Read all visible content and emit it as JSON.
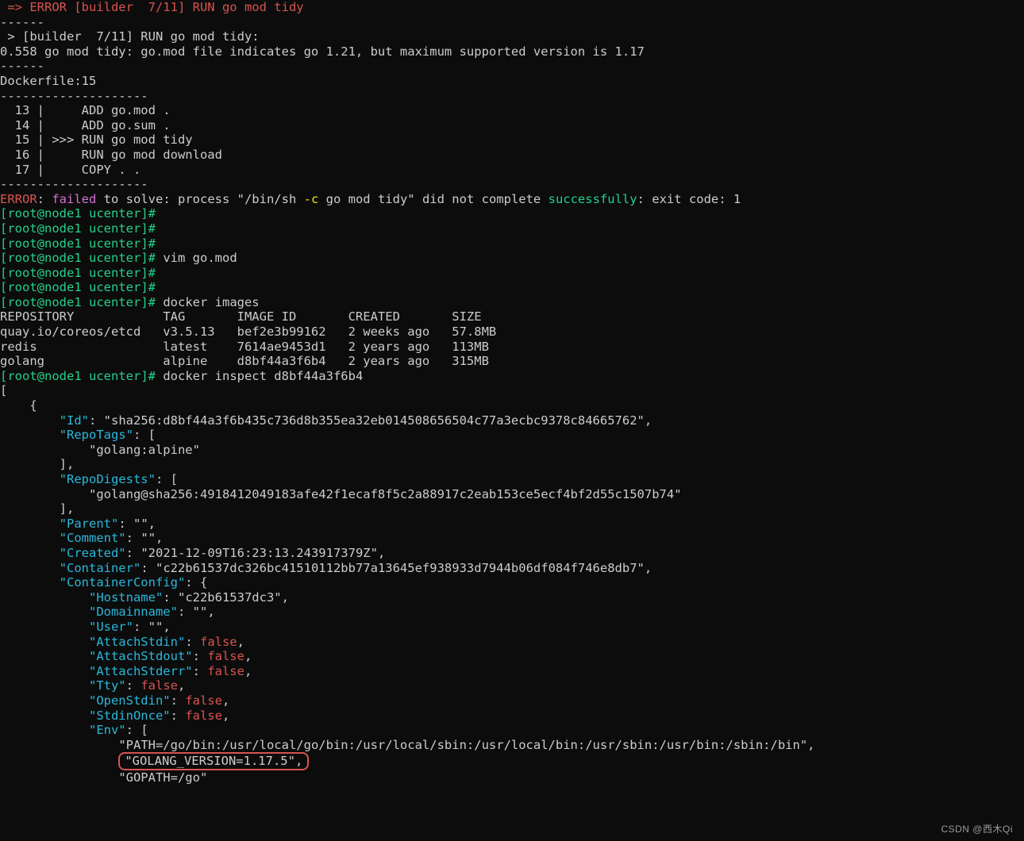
{
  "L01_a": " => ERROR [builder  7/11] RUN go mod tidy",
  "L02_a": "------",
  "L03_a": " > [builder  7/11] RUN go mod tidy:",
  "L04_a": "0.558 go mod tidy: go.mod file indicates go 1.21, but maximum supported version is 1.17",
  "L05_a": "------",
  "L06_a": "Dockerfile:15",
  "L07_a": "--------------------",
  "L08_a": "  13 |     ADD go.mod .",
  "L09_a": "  14 |     ADD go.sum .",
  "L10_a": "  15 | >>> RUN go mod tidy",
  "L11_a": "  16 |     RUN go mod download",
  "L12_a": "  17 |     COPY . .",
  "L13_a": "--------------------",
  "err_a": "ERROR",
  "err_b": ": ",
  "err_c": "failed",
  "err_d": " to solve: process \"/bin/sh ",
  "err_e": "-c",
  "err_f": " go mod tidy\" did not complete ",
  "err_g": "successfully",
  "err_h": ": exit code: 1",
  "p_open": "[",
  "p_text": "root@node1 ucenter",
  "p_close": "]# ",
  "cmd_vim": "vim go.mod",
  "cmd_images": "docker images",
  "hdr": "REPOSITORY            TAG       IMAGE ID       CREATED       SIZE",
  "row1": "quay.io/coreos/etcd   v3.5.13   bef2e3b99162   2 weeks ago   57.8MB",
  "row2": "redis                 latest    7614ae9453d1   2 years ago   113MB",
  "row3": "golang                alpine    d8bf44a3f6b4   2 years ago   315MB",
  "cmd_inspect": "docker inspect d8bf44a3f6b4",
  "j01": "[",
  "j02": "    {",
  "j03a": "        ",
  "j03k": "\"Id\"",
  "j03b": ": ",
  "j03v": "\"sha256:d8bf44a3f6b435c736d8b355ea32eb014508656504c77a3ecbc9378c84665762\"",
  "j03c": ",",
  "j04a": "        ",
  "j04k": "\"RepoTags\"",
  "j04b": ": [",
  "j05a": "            ",
  "j05v": "\"golang:alpine\"",
  "j06": "        ],",
  "j07a": "        ",
  "j07k": "\"RepoDigests\"",
  "j07b": ": [",
  "j08a": "            ",
  "j08v": "\"golang@sha256:4918412049183afe42f1ecaf8f5c2a88917c2eab153ce5ecf4bf2d55c1507b74\"",
  "j09": "        ],",
  "j10a": "        ",
  "j10k": "\"Parent\"",
  "j10b": ": ",
  "j10v": "\"\"",
  "j10c": ",",
  "j11a": "        ",
  "j11k": "\"Comment\"",
  "j11b": ": ",
  "j11v": "\"\"",
  "j11c": ",",
  "j12a": "        ",
  "j12k": "\"Created\"",
  "j12b": ": ",
  "j12v": "\"2021-12-09T16:23:13.243917379Z\"",
  "j12c": ",",
  "j13a": "        ",
  "j13k": "\"Container\"",
  "j13b": ": ",
  "j13v": "\"c22b61537dc326bc41510112bb77a13645ef938933d7944b06df084f746e8db7\"",
  "j13c": ",",
  "j14a": "        ",
  "j14k": "\"ContainerConfig\"",
  "j14b": ": {",
  "j15a": "            ",
  "j15k": "\"Hostname\"",
  "j15b": ": ",
  "j15v": "\"c22b61537dc3\"",
  "j15c": ",",
  "j16a": "            ",
  "j16k": "\"Domainname\"",
  "j16b": ": ",
  "j16v": "\"\"",
  "j16c": ",",
  "j17a": "            ",
  "j17k": "\"User\"",
  "j17b": ": ",
  "j17v": "\"\"",
  "j17c": ",",
  "j18a": "            ",
  "j18k": "\"AttachStdin\"",
  "j18b": ": ",
  "j18v": "false",
  "j18c": ",",
  "j19a": "            ",
  "j19k": "\"AttachStdout\"",
  "j19b": ": ",
  "j19v": "false",
  "j19c": ",",
  "j20a": "            ",
  "j20k": "\"AttachStderr\"",
  "j20b": ": ",
  "j20v": "false",
  "j20c": ",",
  "j21a": "            ",
  "j21k": "\"Tty\"",
  "j21b": ": ",
  "j21v": "false",
  "j21c": ",",
  "j22a": "            ",
  "j22k": "\"OpenStdin\"",
  "j22b": ": ",
  "j22v": "false",
  "j22c": ",",
  "j23a": "            ",
  "j23k": "\"StdinOnce\"",
  "j23b": ": ",
  "j23v": "false",
  "j23c": ",",
  "j24a": "            ",
  "j24k": "\"Env\"",
  "j24b": ": [",
  "j25a": "                ",
  "j25v": "\"PATH=/go/bin:/usr/local/go/bin:/usr/local/sbin:/usr/local/bin:/usr/sbin:/usr/bin:/sbin:/bin\"",
  "j25c": ",",
  "j26a": "                ",
  "j26v": "\"GOLANG_VERSION=1.17.5\"",
  "j26c": ",",
  "j27a": "                ",
  "j27v": "\"GOPATH=/go\"",
  "watermark": "CSDN @西木Qi"
}
